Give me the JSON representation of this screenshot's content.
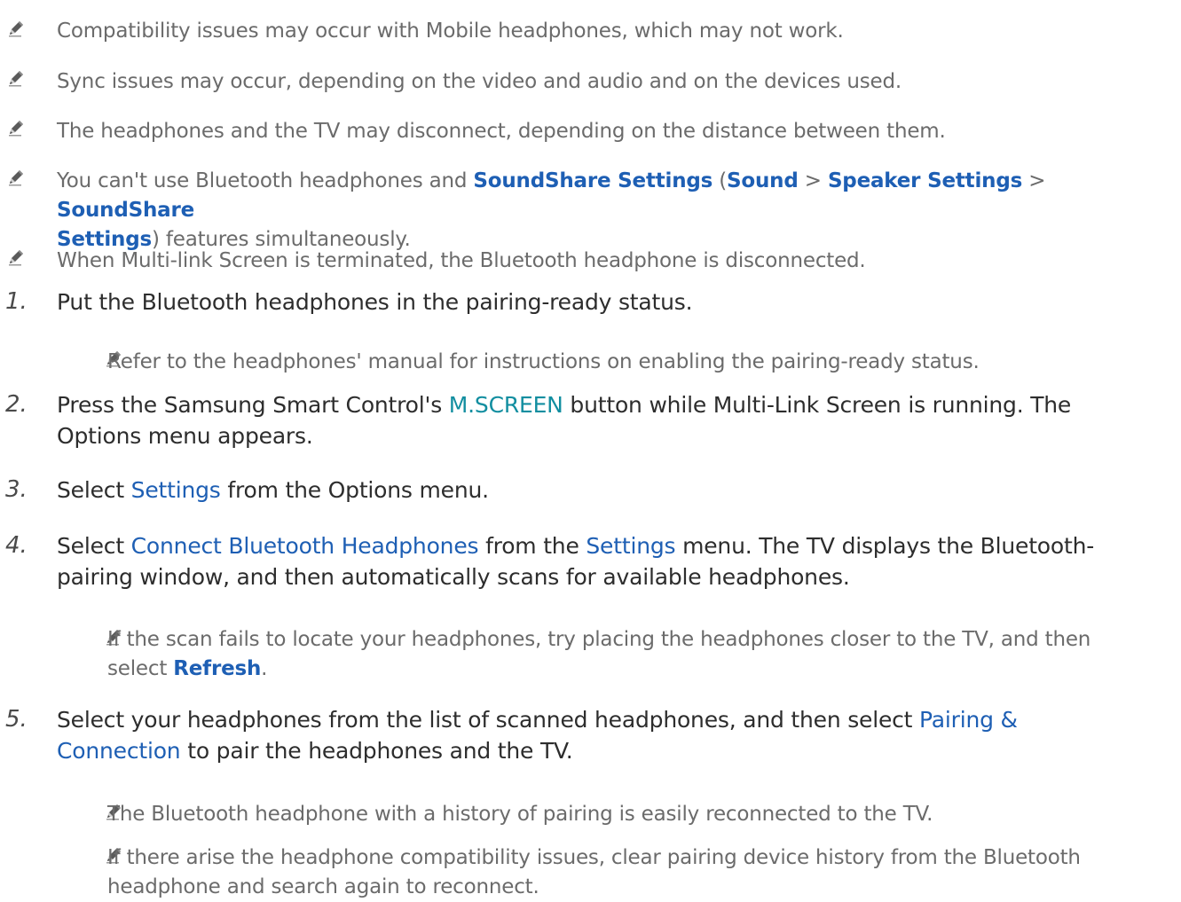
{
  "icons": {
    "note": "pencil-icon"
  },
  "notes_top": [
    "Compatibility issues may occur with Mobile headphones, which may not work.",
    "Sync issues may occur, depending on the video and audio and on the devices used.",
    "The headphones and the TV may disconnect, depending on the distance between them."
  ],
  "note4": {
    "t1": "You can't use Bluetooth headphones and ",
    "h1": "SoundShare Settings",
    "t2": " (",
    "h2": "Sound",
    "t3": " > ",
    "h3": "Speaker Settings",
    "t4": " > ",
    "h4": "SoundShare",
    "h5": "Settings",
    "t5": ") features simultaneously."
  },
  "note5": "When Multi-link Screen is terminated, the Bluetooth headphone is disconnected.",
  "steps": {
    "s1": {
      "num": "1.",
      "text": "Put the Bluetooth headphones in the pairing-ready status.",
      "note": "Refer to the headphones' manual for instructions on enabling the pairing-ready status."
    },
    "s2": {
      "num": "2.",
      "t1": "Press the Samsung Smart Control's ",
      "h1": "M.SCREEN",
      "t2": " button while Multi-Link Screen is running. The",
      "t3": "Options menu appears."
    },
    "s3": {
      "num": "3.",
      "t1": "Select ",
      "h1": "Settings",
      "t2": " from the Options menu."
    },
    "s4": {
      "num": "4.",
      "t1": "Select ",
      "h1": "Connect Bluetooth Headphones",
      "t2": " from the ",
      "h2": "Settings",
      "t3": " menu. The TV displays the Bluetooth-",
      "t4": "pairing window, and then automatically scans for available headphones.",
      "note_l1": "If the scan fails to locate your headphones, try placing the headphones closer to the TV, and then",
      "note_l2a": "select ",
      "note_h": "Refresh",
      "note_l2b": "."
    },
    "s5": {
      "num": "5.",
      "t1": "Select your headphones from the list of scanned headphones, and then select ",
      "h1": "Pairing &",
      "h2": "Connection",
      "t2": " to pair the headphones and the TV.",
      "note1": "The Bluetooth headphone with a history of pairing is easily reconnected to the TV.",
      "note2_l1": "If there arise the headphone compatibility issues, clear pairing device history from the Bluetooth",
      "note2_l2": "headphone and search again to reconnect."
    }
  },
  "colors": {
    "text": "#2d2d2d",
    "note_text": "#6b6b6b",
    "link_blue": "#1e5fb4",
    "teal": "#128ea0"
  }
}
